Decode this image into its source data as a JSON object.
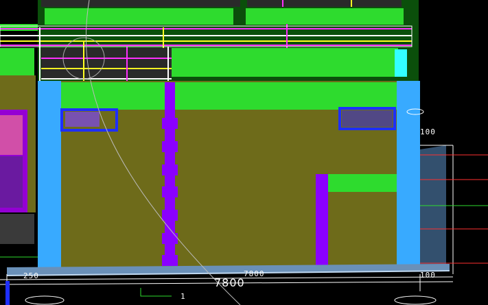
{
  "viewport": {
    "kind": "3D CAD model view"
  },
  "colors": {
    "background": "#000000",
    "wall_olive": "#6e6b1a",
    "slab_green": "#2edb2e",
    "column_blue": "#38aaff",
    "beam_purple": "#8a00ff",
    "window_blue": "#1e2fff",
    "rebar_magenta": "#ff30ff",
    "rebar_yellow": "#ffff22",
    "cyan_block": "#33ffff",
    "pink_panel": "#d14fa8"
  },
  "dimensions": {
    "main_span": "7800",
    "top_span": "7800",
    "left_offset": "250",
    "right_offset": "100",
    "right_mark_upper": "100",
    "level_marker": "1"
  }
}
